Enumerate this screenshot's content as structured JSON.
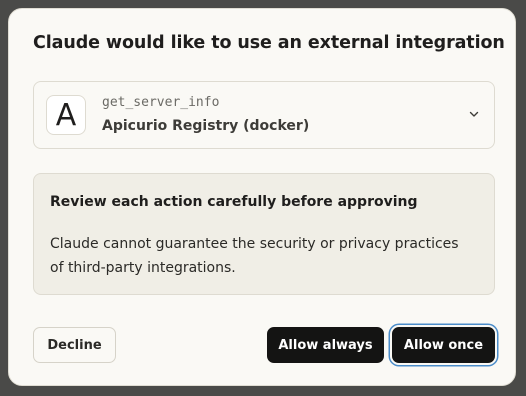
{
  "dialog": {
    "title": "Claude would like to use an external integration"
  },
  "integration": {
    "logo_letter": "A",
    "tool_name": "get_server_info",
    "server_name": "Apicurio Registry (docker)",
    "expand_icon": "chevron-down-icon"
  },
  "warning": {
    "title": "Review each action carefully before approving",
    "body": "Claude cannot guarantee the security or privacy practices of third-party integrations."
  },
  "buttons": {
    "decline": "Decline",
    "allow_always": "Allow always",
    "allow_once": "Allow once"
  },
  "colors": {
    "dialog_background": "#faf9f5",
    "warning_background": "#f0eee6",
    "primary_button": "#141413",
    "focus_ring": "#4a8cc9"
  }
}
